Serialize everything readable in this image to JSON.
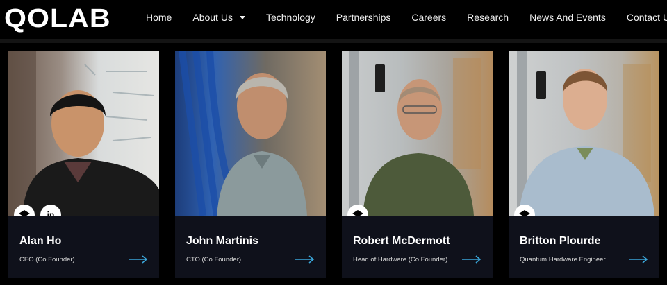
{
  "header": {
    "logo": "QOLAB",
    "nav": [
      {
        "label": "Home"
      },
      {
        "label": "About Us",
        "dropdown": true
      },
      {
        "label": "Technology"
      },
      {
        "label": "Partnerships"
      },
      {
        "label": "Careers"
      },
      {
        "label": "Research"
      },
      {
        "label": "News And Events"
      },
      {
        "label": "Contact Us"
      }
    ]
  },
  "team": [
    {
      "name": "Alan Ho",
      "role": "CEO (Co Founder)",
      "icons": [
        "scholar-icon",
        "linkedin-icon"
      ],
      "linkedin_label": "in"
    },
    {
      "name": "John Martinis",
      "role": "CTO (Co Founder)",
      "icons": []
    },
    {
      "name": "Robert McDermott",
      "role": "Head of Hardware (Co Founder)",
      "icons": [
        "scholar-icon"
      ]
    },
    {
      "name": "Britton Plourde",
      "role": "Quantum Hardware Engineer",
      "icons": [
        "scholar-icon"
      ]
    }
  ],
  "colors": {
    "background": "#000000",
    "card": "#0f111b",
    "accent_arrow": "#3aa6d9"
  }
}
